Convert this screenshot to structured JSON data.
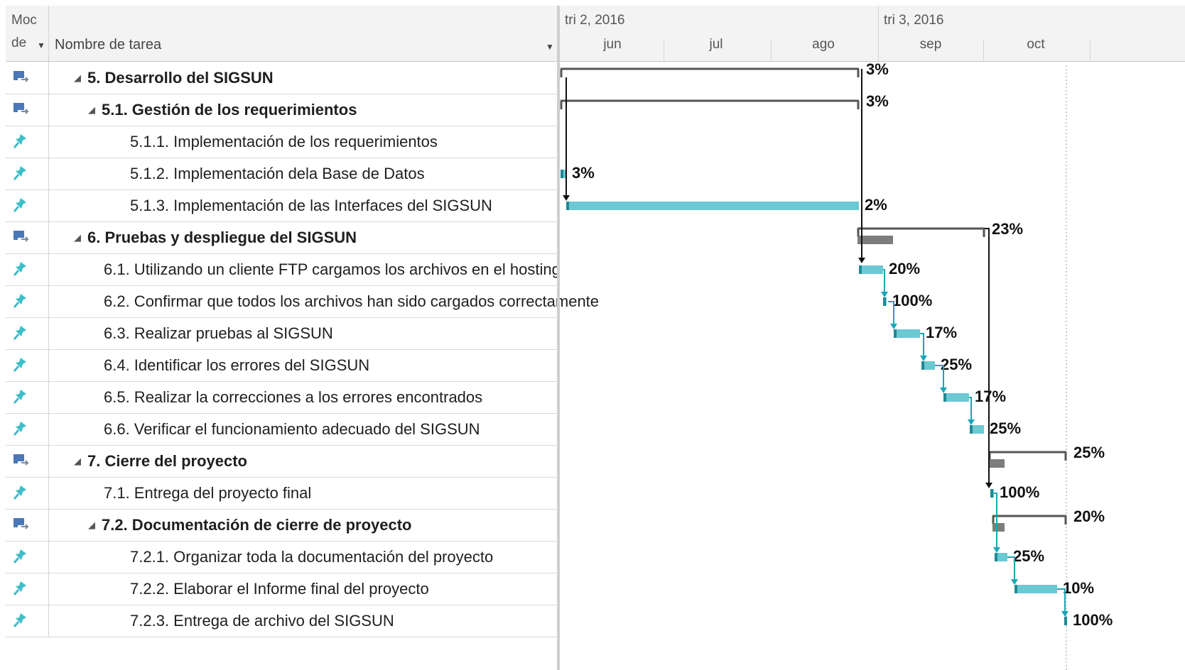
{
  "columns": {
    "mode_header_line1": "Moc",
    "mode_header_line2": "de",
    "name_header": "Nombre de tarea"
  },
  "timescale": {
    "quarters": [
      "tri 2, 2016",
      "tri 3, 2016"
    ],
    "months": [
      "jun",
      "jul",
      "ago",
      "sep",
      "oct"
    ]
  },
  "colors": {
    "task_bar": "#6cc8d2",
    "summary_bar": "#555555",
    "link_arrow": "#1aa6b5",
    "summary_icon": "#4a78b8",
    "task_icon": "#3fbec8"
  },
  "tasks": [
    {
      "name": "5. Desarrollo del SIGSUN",
      "level": 0,
      "summary": true,
      "mode_icon": "auto-schedule-icon",
      "percent": "3%"
    },
    {
      "name": "5.1. Gestión de los requerimientos",
      "level": 1,
      "summary": true,
      "mode_icon": "auto-schedule-icon",
      "percent": "3%"
    },
    {
      "name": "5.1.1. Implementación de los requerimientos",
      "level": 2,
      "summary": false,
      "mode_icon": "manual-schedule-pin-icon",
      "percent": ""
    },
    {
      "name": "5.1.2. Implementación dela Base de Datos",
      "level": 2,
      "summary": false,
      "mode_icon": "manual-schedule-pin-icon",
      "percent": "3%"
    },
    {
      "name": "5.1.3. Implementación de las Interfaces del SIGSUN",
      "level": 2,
      "summary": false,
      "mode_icon": "manual-schedule-pin-icon",
      "percent": "2%"
    },
    {
      "name": "6. Pruebas y despliegue del SIGSUN",
      "level": 0,
      "summary": true,
      "mode_icon": "auto-schedule-icon",
      "percent": "23%"
    },
    {
      "name": "6.1. Utilizando un cliente FTP cargamos los archivos en el hosting",
      "level": 1,
      "summary": false,
      "mode_icon": "manual-schedule-pin-icon",
      "percent": "20%"
    },
    {
      "name": "6.2. Confirmar que todos los archivos han sido cargados correctamente",
      "level": 1,
      "summary": false,
      "mode_icon": "manual-schedule-pin-icon",
      "percent": "100%"
    },
    {
      "name": "6.3. Realizar pruebas al SIGSUN",
      "level": 1,
      "summary": false,
      "mode_icon": "manual-schedule-pin-icon",
      "percent": "17%"
    },
    {
      "name": "6.4. Identificar los errores del SIGSUN",
      "level": 1,
      "summary": false,
      "mode_icon": "manual-schedule-pin-icon",
      "percent": "25%"
    },
    {
      "name": "6.5. Realizar la correcciones a los errores encontrados",
      "level": 1,
      "summary": false,
      "mode_icon": "manual-schedule-pin-icon",
      "percent": "17%"
    },
    {
      "name": "6.6. Verificar el funcionamiento adecuado del SIGSUN",
      "level": 1,
      "summary": false,
      "mode_icon": "manual-schedule-pin-icon",
      "percent": "25%"
    },
    {
      "name": "7. Cierre del proyecto",
      "level": 0,
      "summary": true,
      "mode_icon": "auto-schedule-icon",
      "percent": "25%"
    },
    {
      "name": "7.1. Entrega del proyecto final",
      "level": 1,
      "summary": false,
      "mode_icon": "manual-schedule-pin-icon",
      "percent": "100%"
    },
    {
      "name": "7.2. Documentación de cierre de proyecto",
      "level": 1,
      "summary": true,
      "mode_icon": "auto-schedule-icon",
      "percent": "20%"
    },
    {
      "name": "7.2.1. Organizar toda la documentación del proyecto",
      "level": 2,
      "summary": false,
      "mode_icon": "manual-schedule-pin-icon",
      "percent": "25%"
    },
    {
      "name": "7.2.2. Elaborar el Informe final del proyecto",
      "level": 2,
      "summary": false,
      "mode_icon": "manual-schedule-pin-icon",
      "percent": "10%"
    },
    {
      "name": "7.2.3. Entrega de archivo del SIGSUN",
      "level": 2,
      "summary": false,
      "mode_icon": "manual-schedule-pin-icon",
      "percent": "100%"
    }
  ]
}
